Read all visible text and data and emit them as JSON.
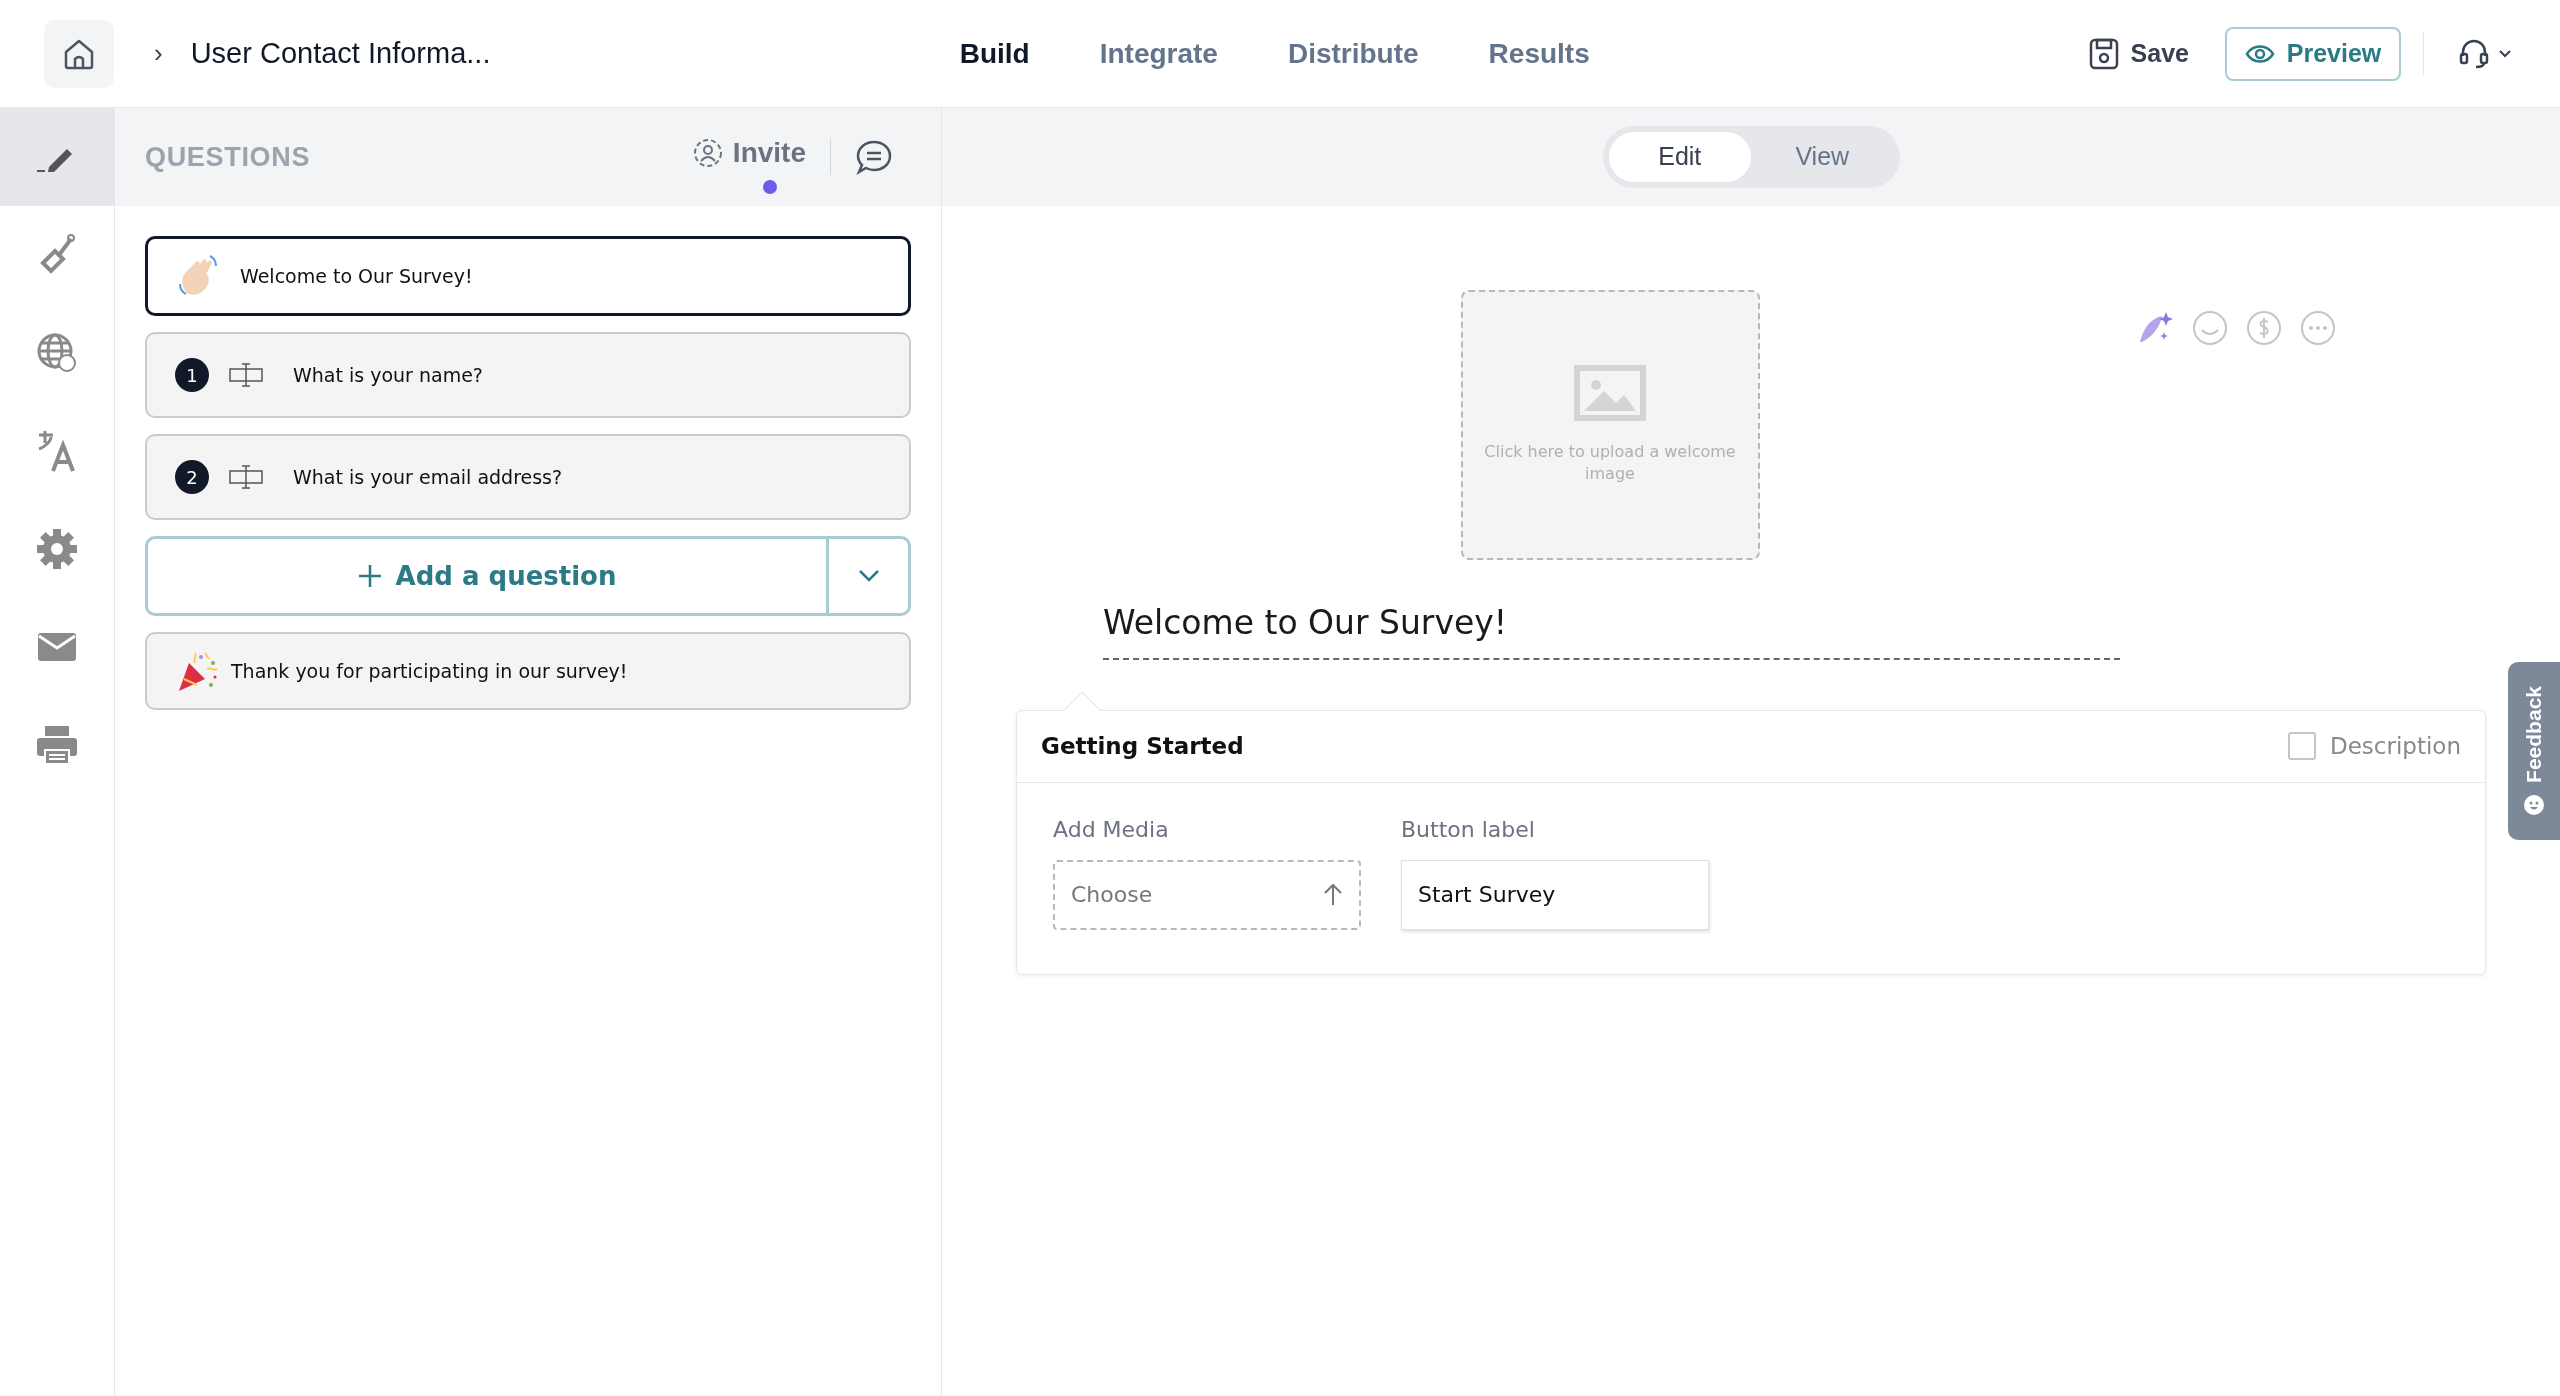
{
  "breadcrumb": {
    "separator": "›",
    "title": "User Contact Informa..."
  },
  "tabs": [
    {
      "label": "Build",
      "selected": true
    },
    {
      "label": "Integrate",
      "selected": false
    },
    {
      "label": "Distribute",
      "selected": false
    },
    {
      "label": "Results",
      "selected": false
    }
  ],
  "actions": {
    "save": "Save",
    "preview": "Preview"
  },
  "rail": [
    {
      "kind": "pen",
      "selected": true
    },
    {
      "kind": "brush",
      "selected": false
    },
    {
      "kind": "globe",
      "selected": false
    },
    {
      "kind": "translate",
      "selected": false
    },
    {
      "kind": "gear",
      "selected": false
    },
    {
      "kind": "mail",
      "selected": false
    },
    {
      "kind": "printer",
      "selected": false
    }
  ],
  "questions_panel": {
    "title": "QUESTIONS",
    "invite": "Invite",
    "invite_notification": true,
    "items": [
      {
        "kind": "welcome",
        "text": "Welcome to Our Survey!",
        "selected": true
      },
      {
        "kind": "question",
        "number": "1",
        "text": "What is your name?",
        "selected": false
      },
      {
        "kind": "question",
        "number": "2",
        "text": "What is your email address?",
        "selected": false
      }
    ],
    "add_button": "Add a question",
    "ending": {
      "kind": "thanks",
      "text": "Thank you for participating in our survey!",
      "selected": false
    }
  },
  "mode_toggle": [
    {
      "label": "Edit",
      "selected": true
    },
    {
      "label": "View",
      "selected": false
    }
  ],
  "upload_hint": "Click here to upload a welcome image",
  "welcome_title": "Welcome to Our Survey!",
  "settings_card": {
    "title": "Getting Started",
    "description": {
      "label": "Description",
      "checked": false
    },
    "media_label": "Add Media",
    "media_placeholder": "Choose",
    "button_label": "Button label",
    "button_value": "Start Survey"
  },
  "feedback_tab": "Feedback"
}
